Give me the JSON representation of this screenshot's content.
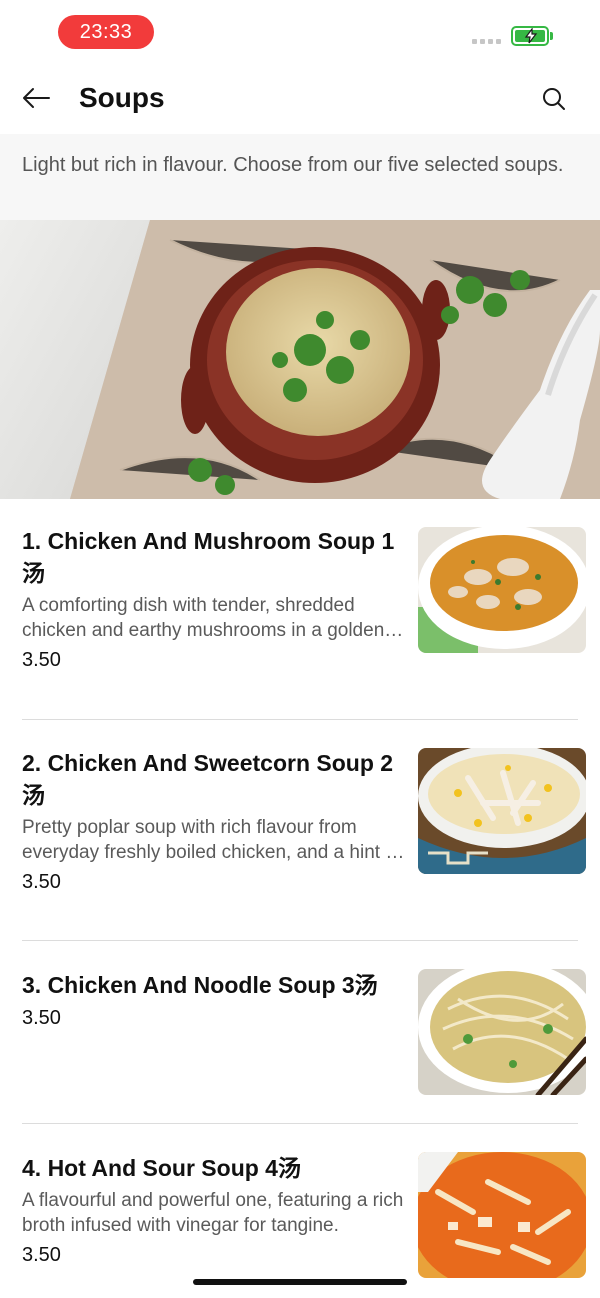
{
  "status_bar": {
    "time": "23:33",
    "battery_color": "#36b844",
    "time_pill_color": "#f23b3b"
  },
  "header": {
    "title": "Soups",
    "back_icon": "arrow-left-icon",
    "search_icon": "search-icon"
  },
  "subtitle": "Light but rich in flavour. Choose from our five selected soups.",
  "items": [
    {
      "name": "1. Chicken And Mushroom Soup 1汤",
      "description": "A comforting dish with tender, shredded chicken and earthy mushrooms in a golden broth.",
      "price": "3.50"
    },
    {
      "name": "2. Chicken And Sweetcorn Soup 2汤",
      "description": "Pretty poplar soup with rich flavour from everyday freshly boiled chicken, and a hint of sweetcorn.",
      "price": "3.50"
    },
    {
      "name": "3. Chicken And Noodle Soup 3汤",
      "description": "",
      "price": "3.50"
    },
    {
      "name": "4. Hot And Sour Soup 4汤",
      "description": "A flavourful and powerful one, featuring a rich broth infused with vinegar for tangine.",
      "price": "3.50"
    }
  ]
}
